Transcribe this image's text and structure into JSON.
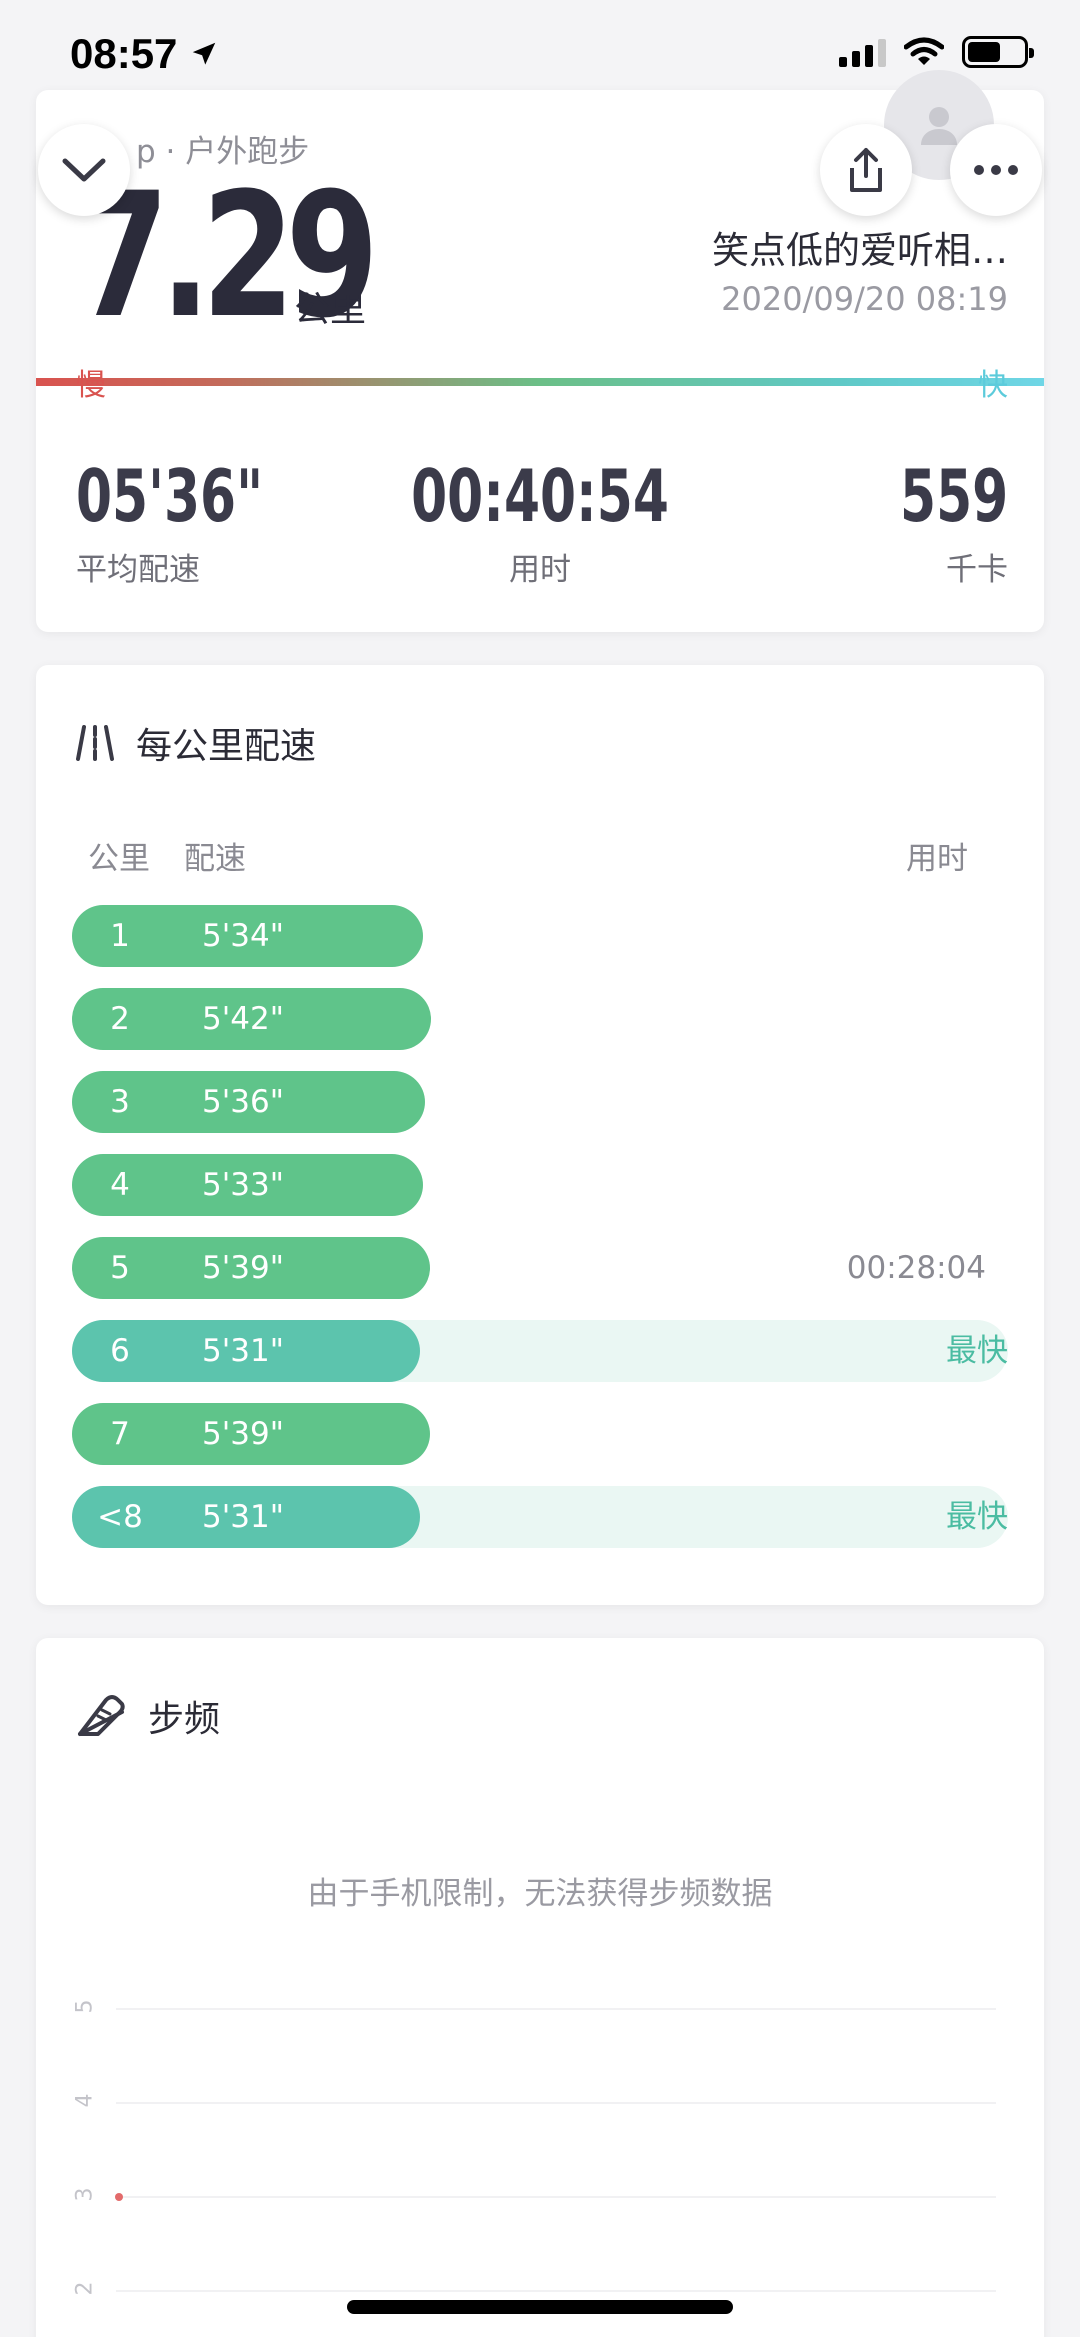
{
  "status_bar": {
    "time": "08:57"
  },
  "summary": {
    "app_type": "p · 户外跑步",
    "distance": "7.29",
    "distance_unit": "公里",
    "username": "笑点低的爱听相…",
    "datetime": "2020/09/20 08:19",
    "slow_label": "慢",
    "fast_label": "快",
    "stats": [
      {
        "value": "05'36\"",
        "label": "平均配速"
      },
      {
        "value": "00:40:54",
        "label": "用时"
      },
      {
        "value": "559",
        "label": "千卡"
      }
    ]
  },
  "pace": {
    "title": "每公里配速",
    "col_km": "公里",
    "col_pace": "配速",
    "col_time": "用时",
    "rows": [
      {
        "km": "1",
        "pace": "5'34\"",
        "fill": 0.375,
        "fastest": false,
        "tag": ""
      },
      {
        "km": "2",
        "pace": "5'42\"",
        "fill": 0.384,
        "fastest": false,
        "tag": ""
      },
      {
        "km": "3",
        "pace": "5'36\"",
        "fill": 0.377,
        "fastest": false,
        "tag": ""
      },
      {
        "km": "4",
        "pace": "5'33\"",
        "fill": 0.375,
        "fastest": false,
        "tag": ""
      },
      {
        "km": "5",
        "pace": "5'39\"",
        "fill": 0.382,
        "fastest": false,
        "tag": "00:28:04"
      },
      {
        "km": "6",
        "pace": "5'31\"",
        "fill": 0.372,
        "fastest": true,
        "tag": "最快"
      },
      {
        "km": "7",
        "pace": "5'39\"",
        "fill": 0.382,
        "fastest": false,
        "tag": ""
      },
      {
        "km": "<8",
        "pace": "5'31\"",
        "fill": 0.372,
        "fastest": true,
        "tag": "最快"
      }
    ]
  },
  "cadence": {
    "title": "步频",
    "message": "由于手机限制，无法获得步频数据",
    "y_ticks": [
      "5",
      "4",
      "3",
      "2"
    ]
  },
  "colors": {
    "pace_bar": "#5fc48a",
    "fastest_bar": "#5cc4ad",
    "slow": "#d9534f",
    "fast": "#5ccbdb"
  }
}
